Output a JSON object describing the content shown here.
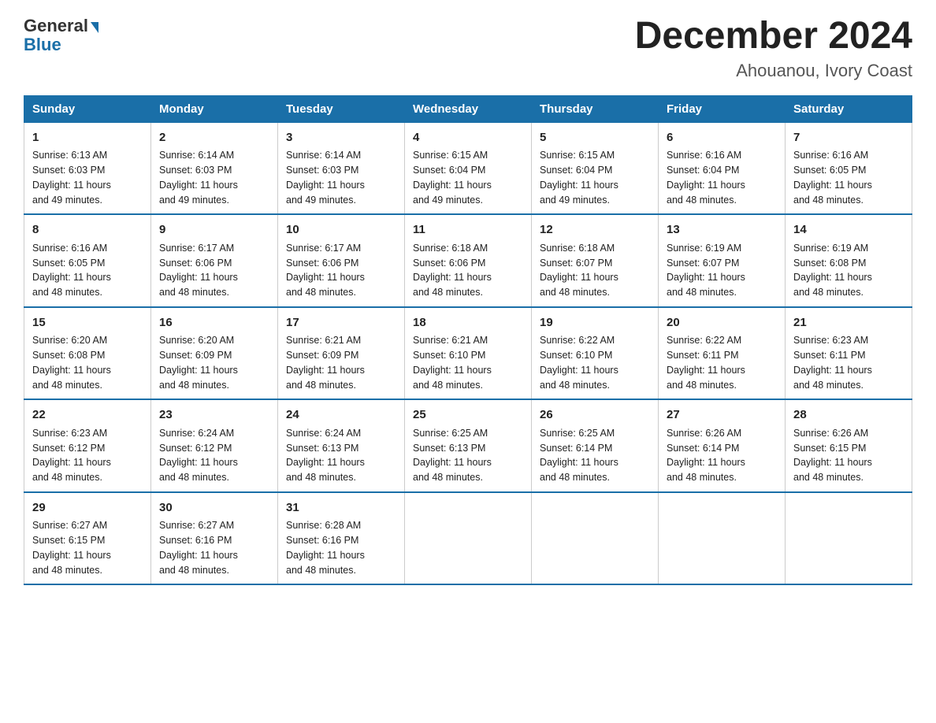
{
  "header": {
    "logo_general": "General",
    "logo_blue": "Blue",
    "month_title": "December 2024",
    "location": "Ahouanou, Ivory Coast"
  },
  "weekdays": [
    "Sunday",
    "Monday",
    "Tuesday",
    "Wednesday",
    "Thursday",
    "Friday",
    "Saturday"
  ],
  "weeks": [
    [
      {
        "day": "1",
        "sunrise": "6:13 AM",
        "sunset": "6:03 PM",
        "daylight": "11 hours and 49 minutes."
      },
      {
        "day": "2",
        "sunrise": "6:14 AM",
        "sunset": "6:03 PM",
        "daylight": "11 hours and 49 minutes."
      },
      {
        "day": "3",
        "sunrise": "6:14 AM",
        "sunset": "6:03 PM",
        "daylight": "11 hours and 49 minutes."
      },
      {
        "day": "4",
        "sunrise": "6:15 AM",
        "sunset": "6:04 PM",
        "daylight": "11 hours and 49 minutes."
      },
      {
        "day": "5",
        "sunrise": "6:15 AM",
        "sunset": "6:04 PM",
        "daylight": "11 hours and 49 minutes."
      },
      {
        "day": "6",
        "sunrise": "6:16 AM",
        "sunset": "6:04 PM",
        "daylight": "11 hours and 48 minutes."
      },
      {
        "day": "7",
        "sunrise": "6:16 AM",
        "sunset": "6:05 PM",
        "daylight": "11 hours and 48 minutes."
      }
    ],
    [
      {
        "day": "8",
        "sunrise": "6:16 AM",
        "sunset": "6:05 PM",
        "daylight": "11 hours and 48 minutes."
      },
      {
        "day": "9",
        "sunrise": "6:17 AM",
        "sunset": "6:06 PM",
        "daylight": "11 hours and 48 minutes."
      },
      {
        "day": "10",
        "sunrise": "6:17 AM",
        "sunset": "6:06 PM",
        "daylight": "11 hours and 48 minutes."
      },
      {
        "day": "11",
        "sunrise": "6:18 AM",
        "sunset": "6:06 PM",
        "daylight": "11 hours and 48 minutes."
      },
      {
        "day": "12",
        "sunrise": "6:18 AM",
        "sunset": "6:07 PM",
        "daylight": "11 hours and 48 minutes."
      },
      {
        "day": "13",
        "sunrise": "6:19 AM",
        "sunset": "6:07 PM",
        "daylight": "11 hours and 48 minutes."
      },
      {
        "day": "14",
        "sunrise": "6:19 AM",
        "sunset": "6:08 PM",
        "daylight": "11 hours and 48 minutes."
      }
    ],
    [
      {
        "day": "15",
        "sunrise": "6:20 AM",
        "sunset": "6:08 PM",
        "daylight": "11 hours and 48 minutes."
      },
      {
        "day": "16",
        "sunrise": "6:20 AM",
        "sunset": "6:09 PM",
        "daylight": "11 hours and 48 minutes."
      },
      {
        "day": "17",
        "sunrise": "6:21 AM",
        "sunset": "6:09 PM",
        "daylight": "11 hours and 48 minutes."
      },
      {
        "day": "18",
        "sunrise": "6:21 AM",
        "sunset": "6:10 PM",
        "daylight": "11 hours and 48 minutes."
      },
      {
        "day": "19",
        "sunrise": "6:22 AM",
        "sunset": "6:10 PM",
        "daylight": "11 hours and 48 minutes."
      },
      {
        "day": "20",
        "sunrise": "6:22 AM",
        "sunset": "6:11 PM",
        "daylight": "11 hours and 48 minutes."
      },
      {
        "day": "21",
        "sunrise": "6:23 AM",
        "sunset": "6:11 PM",
        "daylight": "11 hours and 48 minutes."
      }
    ],
    [
      {
        "day": "22",
        "sunrise": "6:23 AM",
        "sunset": "6:12 PM",
        "daylight": "11 hours and 48 minutes."
      },
      {
        "day": "23",
        "sunrise": "6:24 AM",
        "sunset": "6:12 PM",
        "daylight": "11 hours and 48 minutes."
      },
      {
        "day": "24",
        "sunrise": "6:24 AM",
        "sunset": "6:13 PM",
        "daylight": "11 hours and 48 minutes."
      },
      {
        "day": "25",
        "sunrise": "6:25 AM",
        "sunset": "6:13 PM",
        "daylight": "11 hours and 48 minutes."
      },
      {
        "day": "26",
        "sunrise": "6:25 AM",
        "sunset": "6:14 PM",
        "daylight": "11 hours and 48 minutes."
      },
      {
        "day": "27",
        "sunrise": "6:26 AM",
        "sunset": "6:14 PM",
        "daylight": "11 hours and 48 minutes."
      },
      {
        "day": "28",
        "sunrise": "6:26 AM",
        "sunset": "6:15 PM",
        "daylight": "11 hours and 48 minutes."
      }
    ],
    [
      {
        "day": "29",
        "sunrise": "6:27 AM",
        "sunset": "6:15 PM",
        "daylight": "11 hours and 48 minutes."
      },
      {
        "day": "30",
        "sunrise": "6:27 AM",
        "sunset": "6:16 PM",
        "daylight": "11 hours and 48 minutes."
      },
      {
        "day": "31",
        "sunrise": "6:28 AM",
        "sunset": "6:16 PM",
        "daylight": "11 hours and 48 minutes."
      },
      null,
      null,
      null,
      null
    ]
  ]
}
